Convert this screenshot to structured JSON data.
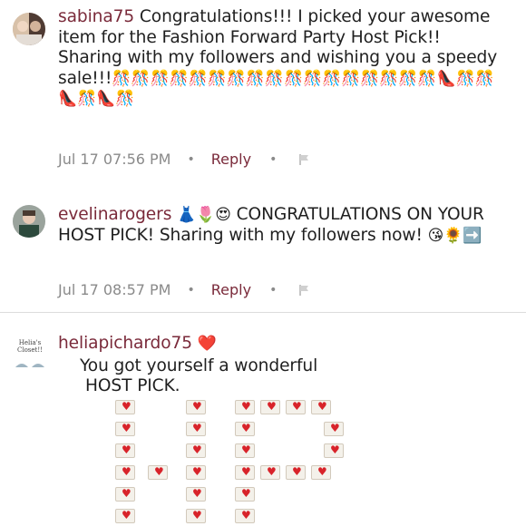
{
  "comments": [
    {
      "username": "sabina75",
      "text": "Congratulations!!! I picked your awesome item for the Fashion Forward Party Host Pick!! Sharing with my followers and wishing you a speedy sale!!!",
      "emoji": "🎊🎊🎊🎊🎊🎊🎊🎊🎊🎊🎊🎊🎊🎊🎊🎊🎊👠🎊🎊👠🎊👠🎊",
      "timestamp": "Jul 17 07:56 PM",
      "reply_label": "Reply"
    },
    {
      "username": "evelinarogers",
      "emoji_prefix": "👗🌷😍",
      "text": "CONGRATULATIONS ON YOUR HOST PICK! Sharing with my followers now!",
      "emoji_suffix": "😘🌻➡️",
      "timestamp": "Jul 17 08:57 PM",
      "reply_label": "Reply"
    },
    {
      "username": "heliapichardo75",
      "avatar_text": "Helia's Closet!!",
      "emoji_after_name": "❤️",
      "text_line1": "You got yourself a wonderful",
      "text_line2": "HOST PICK."
    }
  ],
  "icons": {
    "flag": "flag-icon",
    "heart_envelope": "love-letter-icon"
  },
  "colors": {
    "username": "#7a2a3a",
    "meta": "#8a8a8a",
    "divider": "#dcdcdc"
  }
}
